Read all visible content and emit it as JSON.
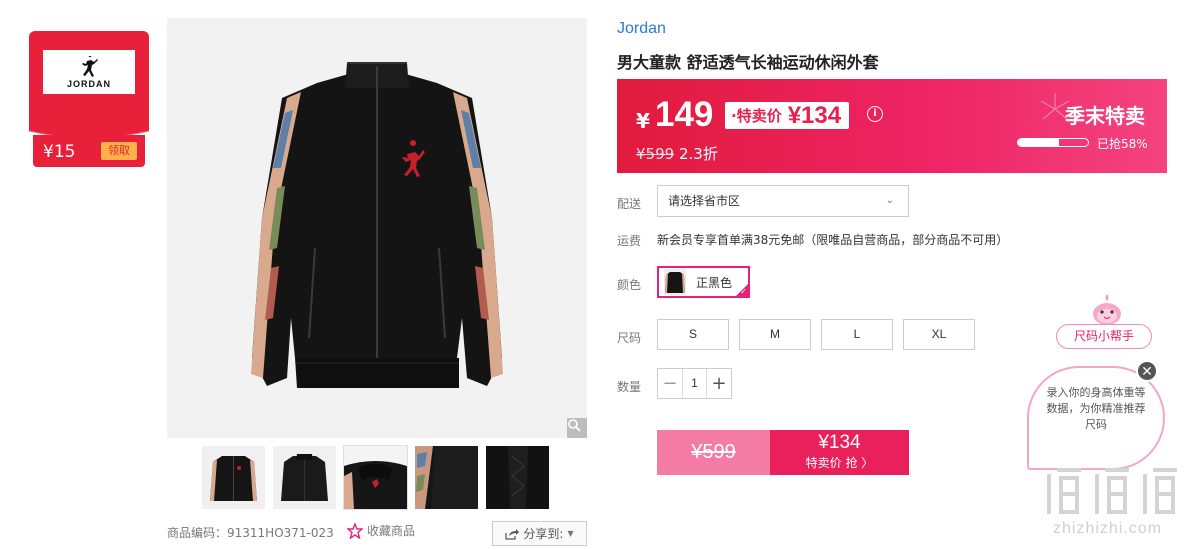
{
  "coupon": {
    "brand": "JORDAN",
    "amount": "¥15",
    "claim_label": "领取"
  },
  "product": {
    "brand": "Jordan",
    "title": "男大童款 舒适透气长袖运动休闲外套",
    "code_label": "商品编码：91311HO371-023",
    "favorite_label": "收藏商品",
    "share_label": "分享到:"
  },
  "price": {
    "currency": "¥",
    "price": "149",
    "special_label": "·特卖价",
    "special_price": "¥134",
    "original_price": "¥599",
    "discount": "2.3折",
    "promo_title": "季末特卖",
    "sold_label": "已抢58%",
    "sold_fraction": 0.58
  },
  "options": {
    "delivery_label": "配送",
    "region_placeholder": "请选择省市区",
    "shipping_label": "运费",
    "shipping_text": "新会员专享首单满38元免邮（限唯品自营商品，部分商品不可用）",
    "color_label": "颜色",
    "color_value": "正黑色",
    "size_label": "尺码",
    "sizes": [
      "S",
      "M",
      "L",
      "XL"
    ],
    "qty_label": "数量",
    "qty_minus": "−",
    "qty_value": "1",
    "qty_plus": "+"
  },
  "buy": {
    "original_price": "¥599",
    "price": "¥134",
    "action_label": "特卖价 抢 〉"
  },
  "helper": {
    "title": "尺码小帮手",
    "message": "录入你的身高体重等数据，为你精准推荐尺码",
    "close": "✕"
  },
  "watermark": {
    "text": "zhizhizhi.com"
  },
  "colors": {
    "accent": "#e8205c",
    "brand_link": "#2a7ad8",
    "coupon_red": "#e8203a"
  }
}
